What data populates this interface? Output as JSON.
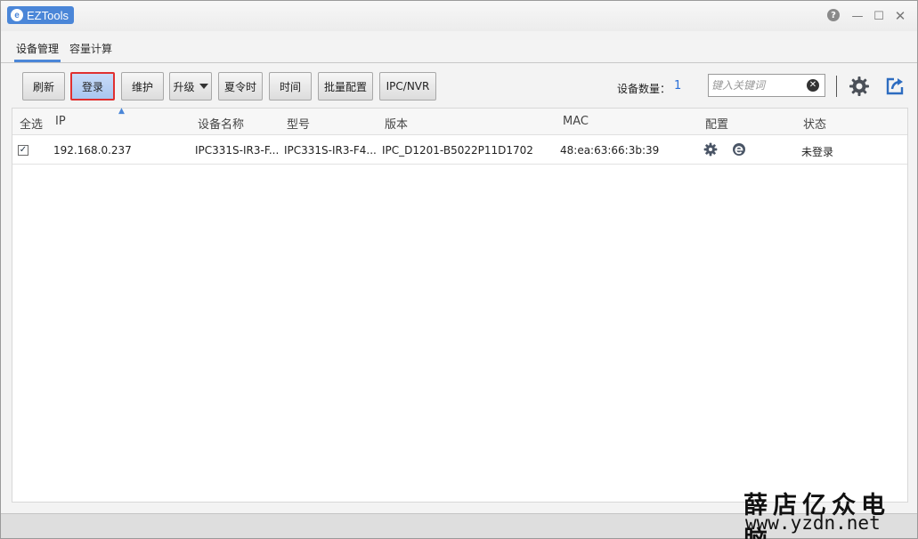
{
  "window": {
    "app_title": "EZTools",
    "app_logo": "e",
    "help_icon": "?",
    "minimize_icon": "—",
    "maximize_icon": "☐",
    "close_icon": "✕"
  },
  "tabs": [
    {
      "label": "设备管理",
      "active": true
    },
    {
      "label": "容量计算",
      "active": false
    }
  ],
  "toolbar": {
    "refresh_label": "刷新",
    "login_label": "登录",
    "maintain_label": "维护",
    "upgrade_label": "升级",
    "dst_label": "夏令时",
    "time_label": "时间",
    "batch_config_label": "批量配置",
    "ipc_nvr_label": "IPC/NVR",
    "device_count_label": "设备数量：",
    "device_count_value": "1",
    "search_placeholder": "键入关键词",
    "search_value": "",
    "search_clear_icon": "✕",
    "icons": {
      "settings": "gear-icon",
      "export": "share-icon"
    }
  },
  "table": {
    "headers": {
      "select_all": "全选",
      "ip": "IP",
      "device_name": "设备名称",
      "model": "型号",
      "version": "版本",
      "mac": "MAC",
      "config": "配置",
      "status": "状态"
    },
    "sort_indicator": "▲",
    "rows": [
      {
        "checked": true,
        "check_mark": "✓",
        "ip": "192.168.0.237",
        "device_name": "IPC331S-IR3-F...",
        "model": "IPC331S-IR3-F4...",
        "version": "IPC_D1201-B5022P11D1702",
        "mac": "48:ea:63:66:3b:39",
        "config_icons": [
          "gear-icon",
          "ie-icon"
        ],
        "status": "未登录"
      }
    ]
  },
  "watermark": {
    "chinese": "薛店亿众电脑",
    "url": "www.yzdn.net"
  },
  "colors": {
    "accent": "#4a86d8",
    "login_highlight_border": "#e03030",
    "count_value": "#2a6fd8"
  }
}
